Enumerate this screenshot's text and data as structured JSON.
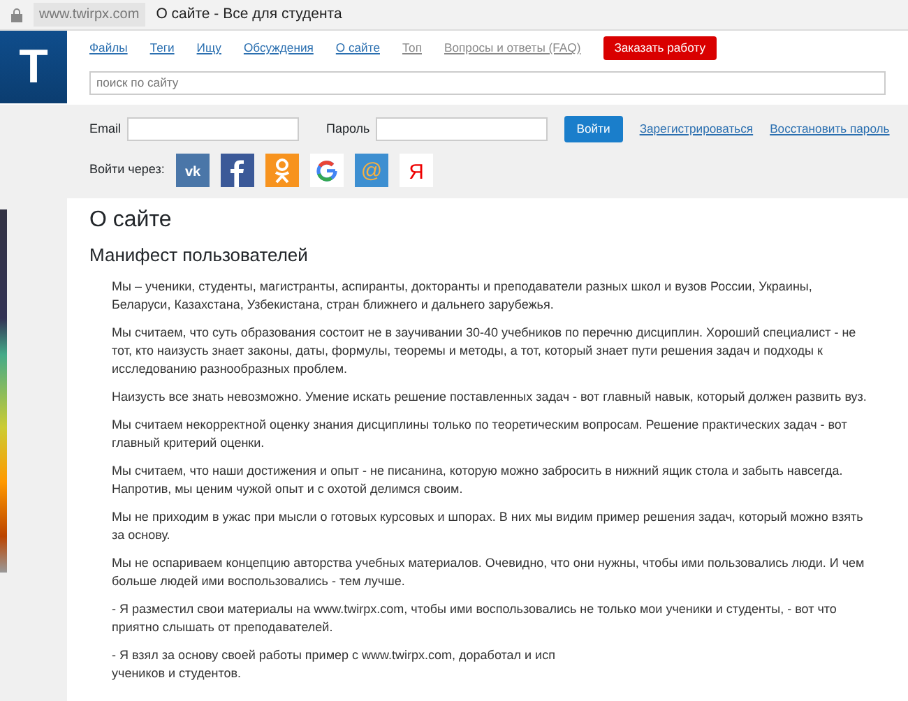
{
  "address_bar": {
    "url": "www.twirpx.com",
    "title": "О сайте - Все для студента"
  },
  "logo": {
    "letter": "T"
  },
  "nav": [
    {
      "label": "Файлы",
      "muted": false
    },
    {
      "label": "Теги",
      "muted": false
    },
    {
      "label": "Ищу",
      "muted": false
    },
    {
      "label": "Обсуждения",
      "muted": false
    },
    {
      "label": "О сайте",
      "muted": false
    },
    {
      "label": "Топ",
      "muted": true
    },
    {
      "label": "Вопросы и ответы (FAQ)",
      "muted": true
    }
  ],
  "order_button": "Заказать работу",
  "search": {
    "placeholder": "поиск по сайту"
  },
  "login": {
    "email_label": "Email",
    "password_label": "Пароль",
    "submit": "Войти",
    "register": "Зарегистрироваться",
    "restore": "Восстановить пароль",
    "social_label": "Войти через:",
    "social": [
      {
        "kind": "vk",
        "color": "#4a76a8"
      },
      {
        "kind": "facebook",
        "color": "#3b5998"
      },
      {
        "kind": "ok",
        "color": "#f7931e"
      },
      {
        "kind": "google",
        "color": "#ffffff"
      },
      {
        "kind": "mail",
        "color": "#3d8fd1",
        "glyph": "@"
      },
      {
        "kind": "yandex",
        "color": "#ffffff",
        "glyph": "Я"
      }
    ]
  },
  "content": {
    "title": "О сайте",
    "subtitle": "Манифест пользователей",
    "paragraphs": [
      "Мы – ученики, студенты, магистранты, аспиранты, докторанты и преподаватели разных школ и вузов России, Украины, Беларуси, Казахстана, Узбекистана, стран ближнего и дальнего зарубежья.",
      "Мы считаем, что суть образования состоит не в заучивании 30-40 учебников по перечню дисциплин. Хороший специалист - не тот, кто наизусть знает законы, даты, формулы, теоремы и методы, а тот, который знает пути решения задач и подходы к исследованию разнообразных проблем.",
      "Наизусть все знать невозможно. Умение искать решение поставленных задач - вот главный навык, который должен развить вуз.",
      "Мы считаем некорректной оценку знания дисциплины только по теоретическим вопросам. Решение практических задач - вот главный критерий оценки.",
      "Мы считаем, что наши достижения и опыт - не писанина, которую можно забросить в нижний ящик стола и забыть навсегда. Напротив, мы ценим чужой опыт и с охотой делимся своим.",
      "Мы не приходим в ужас при мысли о готовых курсовых и шпорах. В них мы видим пример решения задач, который можно взять за основу.",
      "Мы не оспариваем концепцию авторства учебных материалов. Очевидно, что они нужны, чтобы ими пользовались люди. И чем больше людей ими воспользовались - тем лучше.",
      "- Я разместил свои материалы на www.twirpx.com, чтобы ими воспользовались не только мои ученики и студенты, - вот что приятно слышать от преподавателей.",
      "- Я взял за основу своей работы пример с www.twirpx.com, доработал и исп"
    ],
    "paragraph_tail": "учеников и студентов."
  }
}
